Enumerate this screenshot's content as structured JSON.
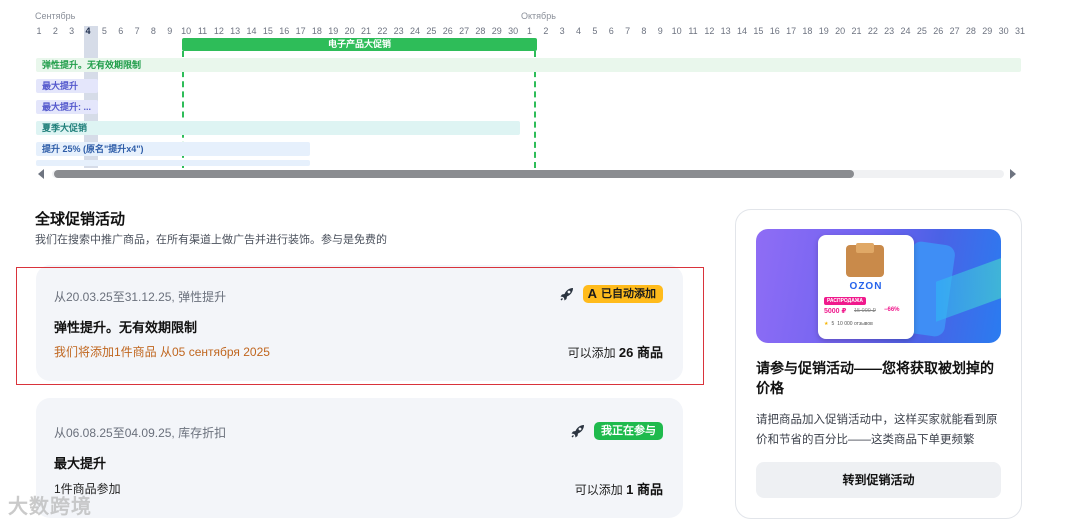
{
  "timeline": {
    "months": [
      {
        "label": "Сентябрь",
        "key": "sep"
      },
      {
        "label": "Октябрь",
        "key": "oct"
      }
    ],
    "sep_days": [
      "1",
      "2",
      "3",
      "4",
      "5",
      "6",
      "7",
      "8",
      "9",
      "10",
      "11",
      "12",
      "13",
      "14",
      "15",
      "16",
      "17",
      "18",
      "19",
      "20",
      "21",
      "22",
      "23",
      "24",
      "25",
      "26",
      "27",
      "28",
      "29",
      "30"
    ],
    "oct_days": [
      "1",
      "2",
      "3",
      "4",
      "5",
      "6",
      "7",
      "8",
      "9",
      "10",
      "11",
      "12",
      "13",
      "14",
      "15",
      "16",
      "17",
      "18",
      "19",
      "20",
      "21",
      "22",
      "23",
      "24",
      "25",
      "26",
      "27",
      "28",
      "29",
      "30",
      "31"
    ],
    "today": "4",
    "event_bar": "电子产品大促销",
    "rows": [
      "弹性提升。无有效期限制",
      "最大提升",
      "最大提升: ...",
      "夏季大促销",
      "提升 25% (原名\"提升x4\")"
    ]
  },
  "section": {
    "title": "全球促销活动",
    "subtitle": "我们在搜索中推广商品，在所有渠道上做广告并进行装饰。参与是免费的"
  },
  "cards": [
    {
      "meta": "从20.03.25至31.12.25, 弹性提升",
      "badge_letter": "A",
      "badge": "已自动添加",
      "title": "弹性提升。无有效期限制",
      "note": "我们将添加1件商品 从05 сентября 2025",
      "add_prefix": "可以添加",
      "add_count": "26 商品"
    },
    {
      "meta": "从06.08.25至04.09.25, 库存折扣",
      "badge": "我正在参与",
      "title": "最大提升",
      "note": "1件商品参加",
      "add_prefix": "可以添加",
      "add_count": "1 商品"
    }
  ],
  "panel": {
    "banner": {
      "brand": "OZON",
      "tag": "РАСПРОДАЖА",
      "price": "5000 ₽",
      "old_price": "15 000 ₽",
      "discount": "−66%",
      "rating": "5",
      "reviews": "10 000 отзывов"
    },
    "title": "请参与促销活动——您将获取被划掉的价格",
    "desc": "请把商品加入促销活动中，这样买家就能看到原价和节省的百分比——这类商品下单更频繁",
    "button": "转到促销活动"
  },
  "watermark": "大数跨境",
  "colors": {
    "green": "#2ebd59",
    "yellow_badge": "#ffbb1c",
    "green_badge": "#1fba4d",
    "note_orange": "#c0661f",
    "selection_red": "#d9333b"
  }
}
